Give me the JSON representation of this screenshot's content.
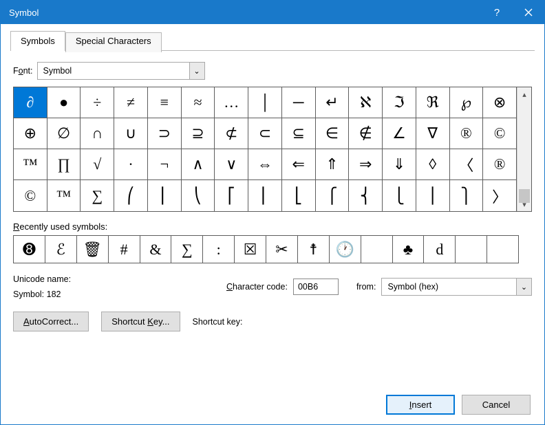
{
  "window": {
    "title": "Symbol"
  },
  "tabs": [
    {
      "label": "Symbols",
      "active": true
    },
    {
      "label": "Special Characters",
      "active": false
    }
  ],
  "font": {
    "label_pre": "F",
    "label_u": "o",
    "label_post": "nt:",
    "value": "Symbol"
  },
  "grid": {
    "selected_index": 0,
    "cells": [
      "∂",
      "●",
      "÷",
      "≠",
      "≡",
      "≈",
      "…",
      "│",
      "─",
      "↵",
      "ℵ",
      "ℑ",
      "ℜ",
      "℘",
      "⊗",
      "⊕",
      "∅",
      "∩",
      "∪",
      "⊃",
      "⊇",
      "⊄",
      "⊂",
      "⊆",
      "∈",
      "∉",
      "∠",
      "∇",
      "®",
      "©",
      "™",
      "∏",
      "√",
      "·",
      "¬",
      "∧",
      "∨",
      "⇔",
      "⇐",
      "⇑",
      "⇒",
      "⇓",
      "◊",
      "〈",
      "®",
      "©",
      "™",
      "∑",
      "⎛",
      "⎜",
      "⎝",
      "⎡",
      "⎢",
      "⎣",
      "⎧",
      "⎨",
      "⎩",
      "⎪",
      "⎫",
      "〉"
    ]
  },
  "recent": {
    "label_pre": "",
    "label_u": "R",
    "label_post": "ecently used symbols:",
    "cells": [
      "➑",
      "ℰ",
      "🗑",
      "#",
      "&",
      "∑",
      ":",
      "☒",
      "✂",
      "☨",
      "🕐",
      "",
      "♣",
      "d",
      "",
      ""
    ]
  },
  "unicode": {
    "name_label": "Unicode name:",
    "name_value": "Symbol: 182"
  },
  "charcode": {
    "label_u": "C",
    "label_post": "haracter code:",
    "value": "00B6"
  },
  "from": {
    "label": "from:",
    "value": "Symbol (hex)"
  },
  "buttons": {
    "autocorrect_u": "A",
    "autocorrect_post": "utoCorrect...",
    "shortcut_pre": "Shortcut ",
    "shortcut_u": "K",
    "shortcut_post": "ey...",
    "shortcut_label": "Shortcut key:",
    "insert_u": "I",
    "insert_post": "nsert",
    "cancel": "Cancel"
  }
}
